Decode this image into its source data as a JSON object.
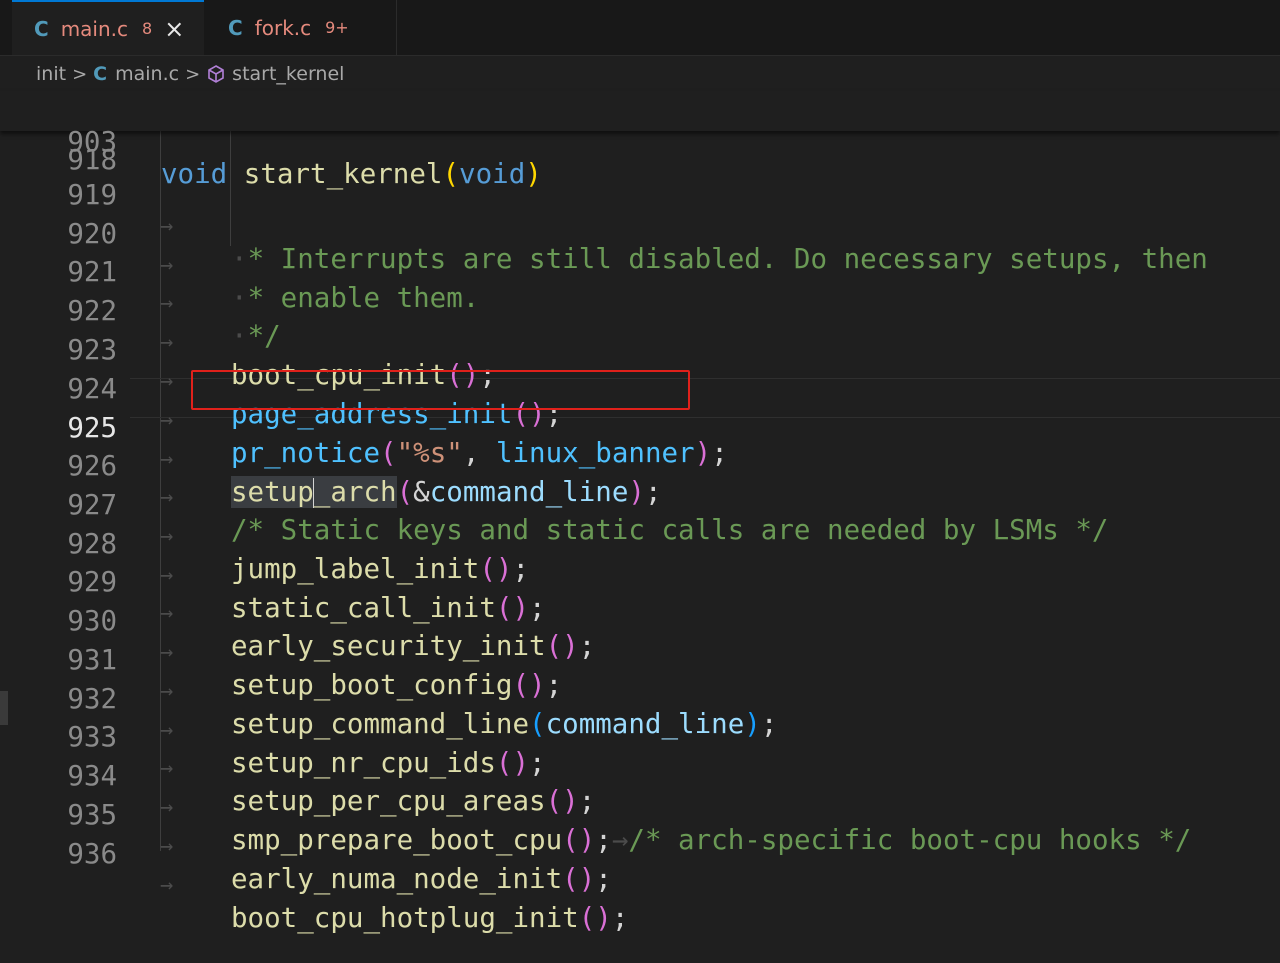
{
  "tabs": [
    {
      "icon": "C",
      "name": "main.c",
      "badge": "8",
      "close": "×"
    },
    {
      "icon": "C",
      "name": "fork.c",
      "badge": "9+"
    }
  ],
  "breadcrumb": {
    "folder": "init",
    "file_icon": "C",
    "file": "main.c",
    "symbol": "start_kernel",
    "sep": ">"
  },
  "sticky": {
    "number": "903",
    "kw1": "void",
    "fn": "start_kernel",
    "open": "(",
    "kw2": "void",
    "close": ")"
  },
  "colors": {
    "accent": "#0078d4",
    "highlight_box": "#e0211b",
    "comment": "#6a9955",
    "keyword": "#569cd6"
  },
  "lines": {
    "l918": {
      "number": "918"
    },
    "l919": {
      "number": "919",
      "text": "* Interrupts are still disabled. Do necessary setups, then"
    },
    "l920": {
      "number": "920",
      "text": "* enable them."
    },
    "l921": {
      "number": "921",
      "text": "*/"
    },
    "l922": {
      "number": "922",
      "fn": "boot_cpu_init",
      "end": ";"
    },
    "l923": {
      "number": "923",
      "fn": "page_address_init",
      "end": ";"
    },
    "l924": {
      "number": "924",
      "fn": "pr_notice",
      "str": "\"%s\"",
      "sep": ", ",
      "arg": "linux_banner",
      "end": ";"
    },
    "l925": {
      "number": "925",
      "fn_a": "setup",
      "fn_b": "_arch",
      "amp": "&",
      "arg": "command_line",
      "end": ";"
    },
    "l926": {
      "number": "926",
      "text": "/* Static keys and static calls are needed by LSMs */"
    },
    "l927": {
      "number": "927",
      "fn": "jump_label_init",
      "end": ";"
    },
    "l928": {
      "number": "928",
      "fn": "static_call_init",
      "end": ";"
    },
    "l929": {
      "number": "929",
      "fn": "early_security_init",
      "end": ";"
    },
    "l930": {
      "number": "930",
      "fn": "setup_boot_config",
      "end": ";"
    },
    "l931": {
      "number": "931",
      "fn": "setup_command_line",
      "arg": "command_line",
      "end": ";"
    },
    "l932": {
      "number": "932",
      "fn": "setup_nr_cpu_ids",
      "end": ";"
    },
    "l933": {
      "number": "933",
      "fn": "setup_per_cpu_areas",
      "end": ";"
    },
    "l934": {
      "number": "934",
      "fn": "smp_prepare_boot_cpu",
      "end": ";",
      "comment": "/* arch-specific boot-cpu hooks */"
    },
    "l935": {
      "number": "935",
      "fn": "early_numa_node_init",
      "end": ";"
    },
    "l936": {
      "number": "936",
      "fn": "boot_cpu_hotplug_init",
      "end": ";"
    }
  },
  "glyphs": {
    "tab_arrow": "→",
    "dot": "·",
    "open": "(",
    "close": ")"
  }
}
